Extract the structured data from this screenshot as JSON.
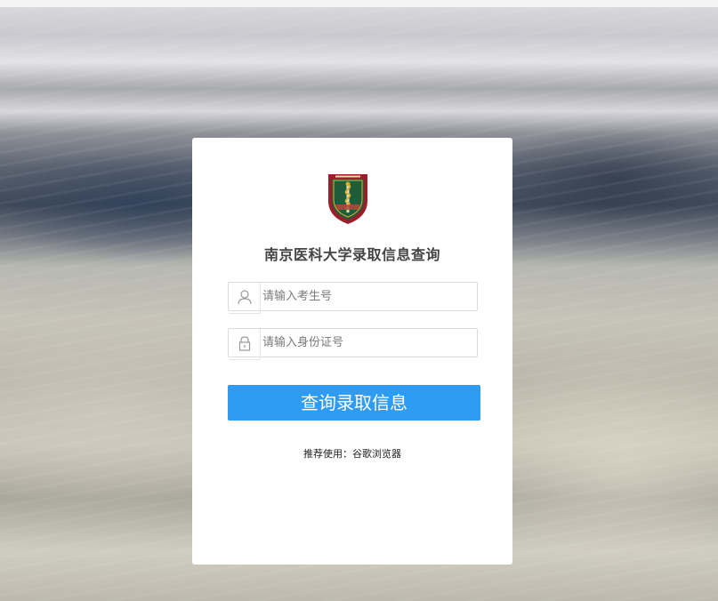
{
  "page": {
    "title": "南京医科大学录取信息查询"
  },
  "logo": {
    "name": "南京医科大学校徽",
    "colors": {
      "frame": "#9b1e2a",
      "field": "#1f5c3a",
      "accent": "#d7b03a"
    }
  },
  "form": {
    "candidate_no": {
      "placeholder": "请输入考生号",
      "value": "",
      "icon": "user-icon"
    },
    "id_no": {
      "placeholder": "请输入身份证号",
      "value": "",
      "icon": "lock-icon"
    },
    "submit_label": "查询录取信息"
  },
  "footer": {
    "recommend": "推荐使用：谷歌浏览器"
  },
  "colors": {
    "button": "#2f9bf2",
    "card": "#ffffff",
    "border": "#d9dbe0"
  }
}
